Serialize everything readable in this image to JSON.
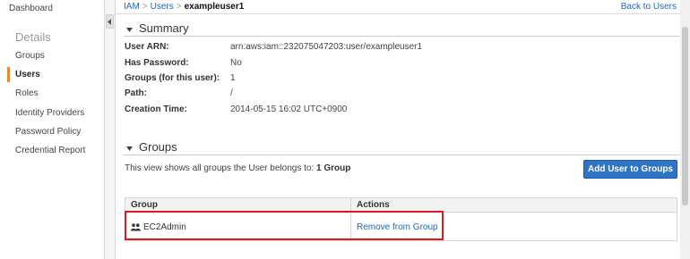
{
  "sidebar": {
    "dashboard_label": "Dashboard",
    "details_heading": "Details",
    "items": [
      {
        "label": "Groups"
      },
      {
        "label": "Users"
      },
      {
        "label": "Roles"
      },
      {
        "label": "Identity Providers"
      },
      {
        "label": "Password Policy"
      },
      {
        "label": "Credential Report"
      }
    ],
    "active_color": "#e88a2f"
  },
  "breadcrumb": {
    "root": "IAM",
    "section": "Users",
    "current": "exampleuser1",
    "separator": ">"
  },
  "header": {
    "back_link": "Back to Users"
  },
  "summary": {
    "title": "Summary",
    "properties": [
      {
        "label": "User ARN:",
        "value": "arn:aws:iam::232075047203:user/exampleuser1"
      },
      {
        "label": "Has Password:",
        "value": "No"
      },
      {
        "label": "Groups (for this user):",
        "value": "1"
      },
      {
        "label": "Path:",
        "value": "/"
      },
      {
        "label": "Creation Time:",
        "value": "2014-05-15 16:02 UTC+0900"
      }
    ]
  },
  "groups": {
    "title": "Groups",
    "note_prefix": "This view shows all groups the User belongs to:",
    "note_count": "1 Group",
    "add_button": "Add User to Groups",
    "table": {
      "headers": {
        "group": "Group",
        "actions": "Actions"
      },
      "rows": [
        {
          "group": "EC2Admin",
          "action": "Remove from Group",
          "icon": "users-icon"
        }
      ]
    }
  },
  "colors": {
    "link": "#1f66b3",
    "primary_button": "#2e75c4",
    "highlight_box": "#e0191f"
  }
}
